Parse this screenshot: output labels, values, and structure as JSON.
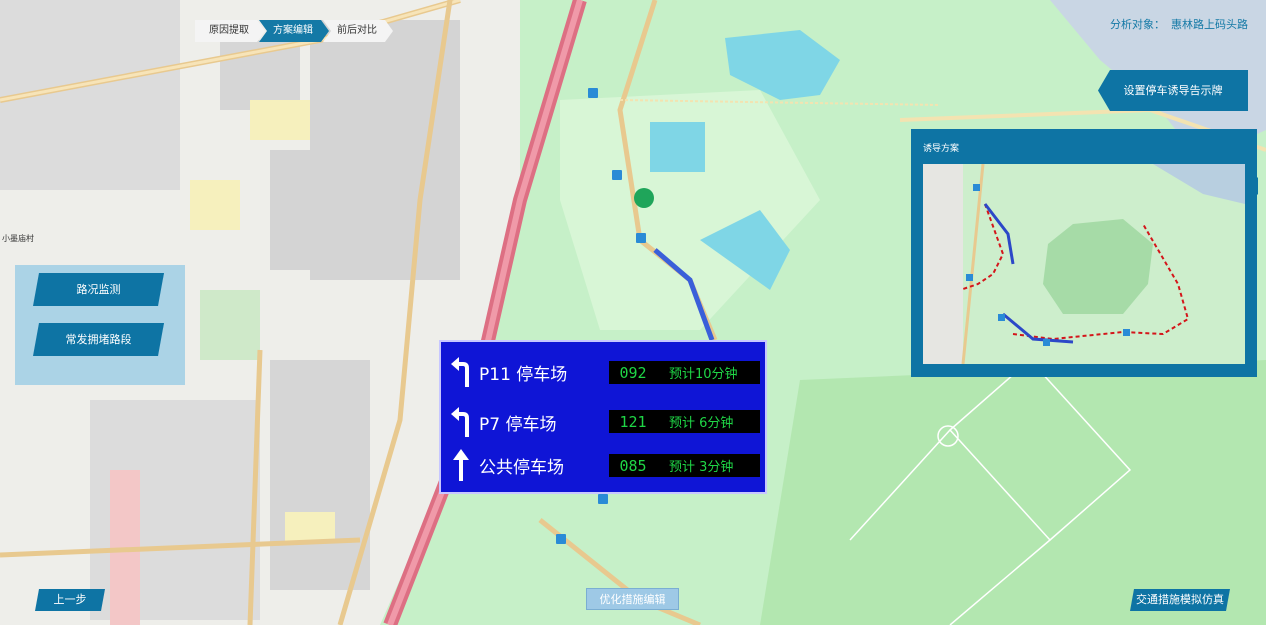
{
  "steps": [
    {
      "label": "原因提取",
      "active": false
    },
    {
      "label": "方案编辑",
      "active": true
    },
    {
      "label": "前后对比",
      "active": false
    }
  ],
  "header": {
    "prefix": "分析对象：",
    "object": "惠林路上码头路"
  },
  "left_buttons": {
    "road_monitor": "路况监测",
    "congestion": "常发拥堵路段"
  },
  "set_sign_button": "设置停车诱导告示牌",
  "guidance_panel": {
    "title": "诱导方案"
  },
  "sign": {
    "rows": [
      {
        "arrow": "turn-left-arrow-icon",
        "name": "P11 停车场",
        "count": "092",
        "time": "预计10分钟"
      },
      {
        "arrow": "turn-left-arrow-icon",
        "name": "P7 停车场",
        "count": "121",
        "time": "预计 6分钟"
      },
      {
        "arrow": "straight-arrow-icon",
        "name": "公共停车场",
        "count": "085",
        "time": "预计 3分钟"
      }
    ]
  },
  "bottom": {
    "prev": "上一步",
    "optimize": "优化措施编辑",
    "simulate": "交通措施模拟仿真"
  },
  "map_labels": {
    "village": "小墨庙村"
  },
  "colors": {
    "accent": "#0e74a4",
    "sign_bg": "#0f15d6",
    "led_text": "#1fd646"
  }
}
